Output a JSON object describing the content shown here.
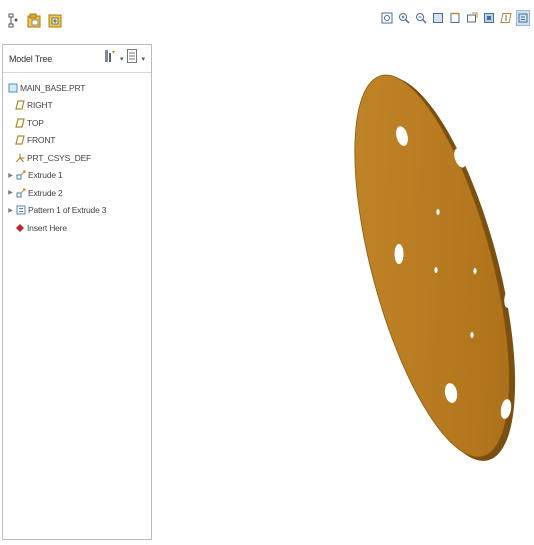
{
  "top_toolbar": {
    "buttons": [
      {
        "name": "tree-structure-icon"
      },
      {
        "name": "open-folder-icon"
      },
      {
        "name": "add-to-model-icon"
      }
    ]
  },
  "model_tree": {
    "title": "Model Tree",
    "settings_icon": "tree-settings-icon",
    "filter_icon": "tree-filter-icon",
    "items": [
      {
        "label": "MAIN_BASE.PRT",
        "icon": "part-icon",
        "expandable": false
      },
      {
        "label": "RIGHT",
        "icon": "datum-plane-icon",
        "expandable": false
      },
      {
        "label": "TOP",
        "icon": "datum-plane-icon",
        "expandable": false
      },
      {
        "label": "FRONT",
        "icon": "datum-plane-icon",
        "expandable": false
      },
      {
        "label": "PRT_CSYS_DEF",
        "icon": "csys-icon",
        "expandable": false
      },
      {
        "label": "Extrude 1",
        "icon": "extrude-icon",
        "expandable": true
      },
      {
        "label": "Extrude 2",
        "icon": "extrude-icon",
        "expandable": true
      },
      {
        "label": "Pattern 1 of Extrude 3",
        "icon": "pattern-icon",
        "expandable": true
      },
      {
        "label": "Insert Here",
        "icon": "insert-marker-icon",
        "expandable": false
      }
    ]
  },
  "view_toolbar": {
    "buttons": [
      "refit-icon",
      "zoom-in-icon",
      "zoom-out-icon",
      "repaint-icon",
      "orient-icon",
      "saved-views-icon",
      "display-style-icon",
      "datum-display-icon",
      "annotation-display-icon",
      "spin-center-icon"
    ]
  },
  "colors": {
    "part_face": "#b7791f",
    "part_edge": "#7a4f10",
    "datum_plane": "#b2892a",
    "panel_border": "#b9bcc0"
  }
}
